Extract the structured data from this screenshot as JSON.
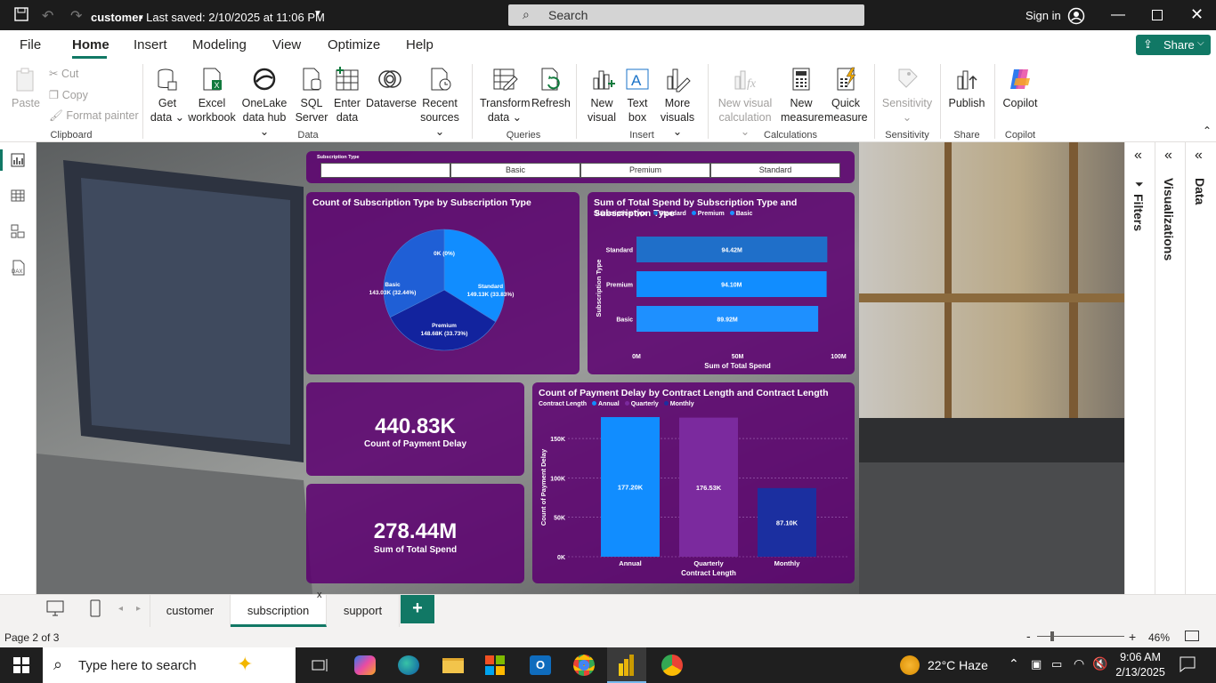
{
  "title_bar": {
    "doc_name": "customer",
    "saved_status": "• Last saved: 2/10/2025 at 11:06 PM",
    "search_placeholder": "Search",
    "sign_in": "Sign in"
  },
  "menu": {
    "tabs": [
      "File",
      "Home",
      "Insert",
      "Modeling",
      "View",
      "Optimize",
      "Help"
    ],
    "active": "Home",
    "share": "Share"
  },
  "ribbon": {
    "clipboard": {
      "paste": "Paste",
      "cut": "Cut",
      "copy": "Copy",
      "format_painter": "Format painter",
      "group": "Clipboard"
    },
    "data": {
      "get_data": [
        "Get",
        "data"
      ],
      "excel": [
        "Excel",
        "workbook"
      ],
      "onelake": [
        "OneLake",
        "data hub"
      ],
      "sql": [
        "SQL",
        "Server"
      ],
      "enter": [
        "Enter",
        "data"
      ],
      "dataverse": "Dataverse",
      "recent": [
        "Recent",
        "sources"
      ],
      "group": "Data"
    },
    "queries": {
      "transform": [
        "Transform",
        "data"
      ],
      "refresh": "Refresh",
      "group": "Queries"
    },
    "insert": {
      "new_visual": [
        "New",
        "visual"
      ],
      "text_box": [
        "Text",
        "box"
      ],
      "more_visuals": [
        "More",
        "visuals"
      ],
      "group": "Insert"
    },
    "calculations": {
      "new_visual_calc": [
        "New visual",
        "calculation"
      ],
      "new_measure": [
        "New",
        "measure"
      ],
      "quick_measure": [
        "Quick",
        "measure"
      ],
      "group": "Calculations"
    },
    "sensitivity": {
      "label": "Sensitivity",
      "group": "Sensitivity"
    },
    "share": {
      "publish": "Publish",
      "group": "Share"
    },
    "copilot": {
      "label": "Copilot",
      "group": "Copilot"
    }
  },
  "slicer": {
    "title": "Subscription Type",
    "options": [
      "",
      "Basic",
      "Premium",
      "Standard"
    ]
  },
  "pie": {
    "title": "Count of Subscription Type by Subscription Type",
    "colors": [
      "#118dff",
      "#12239e",
      "#1f5fd6",
      "#1a90ff"
    ]
  },
  "bar_chart": {
    "title": "Sum of Total Spend by Subscription Type and Subscription Type",
    "legend_title": "Subscription Type",
    "legend": [
      "Standard",
      "Premium",
      "Basic"
    ],
    "legend_colors": [
      "#1f6fc9",
      "#118dff",
      "#1e90ff"
    ]
  },
  "col_chart": {
    "title": "Count of Payment Delay by Contract Length and Contract Length",
    "legend_title": "Contract Length",
    "legend": [
      "Annual",
      "Quarterly",
      "Monthly"
    ],
    "colors": [
      "#118dff",
      "#7b2a9e",
      "#1b2fa0"
    ]
  },
  "card1": {
    "value": "440.83K",
    "label": "Count of Payment Delay"
  },
  "card2": {
    "value": "278.44M",
    "label": "Sum of Total Spend"
  },
  "chart_data": [
    {
      "type": "pie",
      "title": "Count of Subscription Type by Subscription Type",
      "slices": [
        {
          "label": "Standard",
          "value": 149.13,
          "text": "Standard\n149.13K (33.83%)"
        },
        {
          "label": "Premium",
          "value": 148.68,
          "text": "Premium\n148.68K (33.73%)"
        },
        {
          "label": "Basic",
          "value": 143.03,
          "text": "Basic\n143.03K (32.44%)"
        },
        {
          "label": "",
          "value": 0,
          "text": "0K (0%)"
        }
      ]
    },
    {
      "type": "bar",
      "title": "Sum of Total Spend by Subscription Type and Subscription Type",
      "orientation": "horizontal",
      "categories": [
        "Standard",
        "Premium",
        "Basic"
      ],
      "values": [
        94.42,
        94.1,
        89.92
      ],
      "data_labels": [
        "94.42M",
        "94.10M",
        "89.92M"
      ],
      "xlabel": "Sum of Total Spend",
      "ylabel": "Subscription Type",
      "xticks": [
        "0M",
        "50M",
        "100M"
      ],
      "xlim": [
        0,
        100
      ]
    },
    {
      "type": "bar",
      "title": "Count of Payment Delay by Contract Length and Contract Length",
      "categories": [
        "Annual",
        "Quarterly",
        "Monthly"
      ],
      "values": [
        177.2,
        176.53,
        87.1
      ],
      "data_labels": [
        "177.20K",
        "176.53K",
        "87.10K"
      ],
      "xlabel": "Contract Length",
      "ylabel": "Count of Payment Delay",
      "yticks": [
        "0K",
        "50K",
        "100K",
        "150K"
      ],
      "ylim": [
        0,
        177.2
      ],
      "grid": true
    }
  ],
  "right_panes": {
    "filters": "Filters",
    "visualizations": "Visualizations",
    "data": "Data"
  },
  "page_tabs": {
    "tabs": [
      "customer",
      "subscription",
      "support"
    ],
    "active": "subscription",
    "close": "x",
    "add": "+"
  },
  "status": {
    "page": "Page 2 of 3",
    "zoom": "46%"
  },
  "taskbar": {
    "search_placeholder": "Type here to search",
    "weather": "22°C Haze",
    "time": "9:06 AM",
    "date": "2/13/2025"
  }
}
